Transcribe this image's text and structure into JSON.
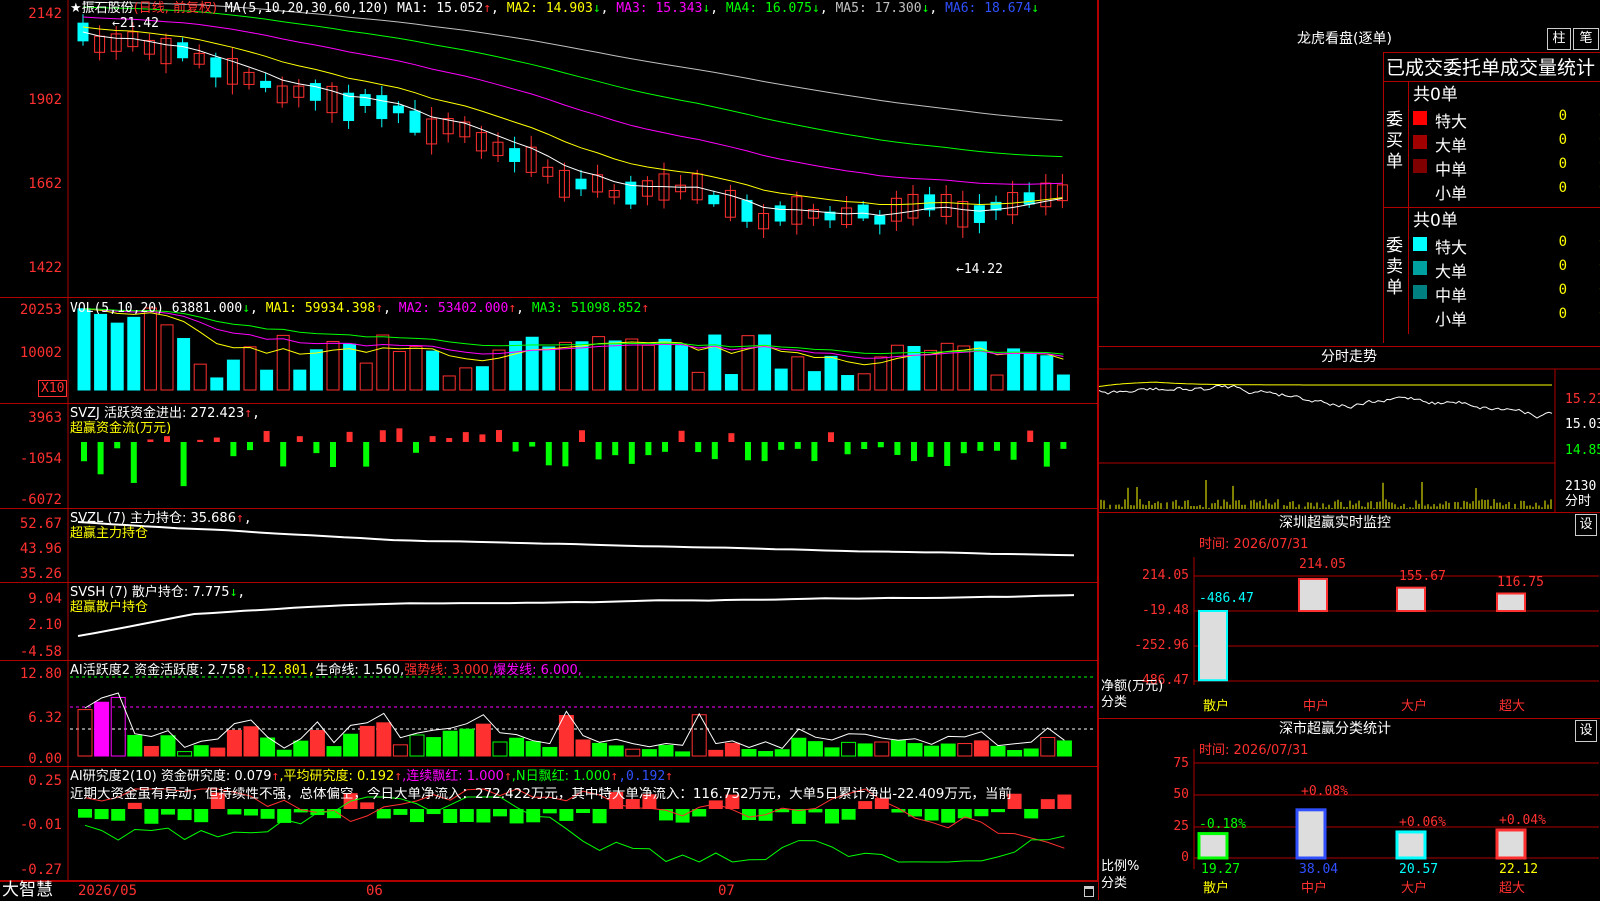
{
  "colors": {
    "up": "#ff3030",
    "down": "#00ffff",
    "ma1": "#ffffff",
    "ma2": "#ffff00",
    "ma3": "#ff00ff",
    "ma4": "#00ff00",
    "ma5": "#c0c0c0",
    "ma6": "#3050ff",
    "grid": "#b00000"
  },
  "header": {
    "stock": "★振石股份",
    "period": "(日线, 前复权)",
    "ma_label": "MA(5,10,20,30,60,120)",
    "ma": [
      {
        "name": "MA1:",
        "value": "15.052",
        "arrow": "↑"
      },
      {
        "name": "MA2:",
        "value": "14.903",
        "arrow": "↓"
      },
      {
        "name": "MA3:",
        "value": "15.343",
        "arrow": "↓"
      },
      {
        "name": "MA4:",
        "value": "16.075",
        "arrow": "↓"
      },
      {
        "name": "MA5:",
        "value": "17.300",
        "arrow": "↓"
      },
      {
        "name": "MA6:",
        "value": "18.674",
        "arrow": "↓"
      }
    ]
  },
  "price_axis": [
    "2142",
    "1902",
    "1662",
    "1422"
  ],
  "price_marks": {
    "high": "←21.42",
    "low": "←14.22"
  },
  "vol": {
    "label": "VOL(5,10,20)",
    "value": "63881.000",
    "arrow": "↓",
    "ma1": "MA1: 59934.398",
    "ma1_arrow": "↑",
    "ma2": "MA2: 53402.000",
    "ma2_arrow": "↑",
    "ma3": "MA3: 51098.852",
    "ma3_arrow": "↑",
    "axis": [
      "20253",
      "10002"
    ],
    "mult": "X10"
  },
  "svzj": {
    "label": "SVZJ  活跃资金进出: 272.423",
    "arrow": "↑",
    "sub": "超赢资金流(万元)",
    "axis": [
      "3963",
      "-1054",
      "-6072"
    ]
  },
  "svzl": {
    "label": "SVZL (7) 主力持仓: 35.686",
    "arrow": "↑",
    "comma": ",",
    "sub": "超赢主力持仓",
    "axis": [
      "52.67",
      "43.96",
      "35.26"
    ]
  },
  "svsh": {
    "label": "SVSH (7) 散户持仓: 7.775",
    "arrow": "↓",
    "comma": ",",
    "sub": "超赢散户持仓",
    "axis": [
      "9.04",
      "2.10",
      "-4.58"
    ]
  },
  "ai1": {
    "label": "AI活跃度2 资金活跃度: 2.758",
    "arrow": "↑",
    "v2": ",12.801,",
    "v3": "生命线: 1.560,",
    "v4": "强势线: 3.000,",
    "v5": "爆发线: 6.000,",
    "axis": [
      "12.80",
      "6.32",
      "0.00"
    ]
  },
  "ai2": {
    "label": "AI研究度2(10) 资金研究度: 0.079",
    "arrow": "↑",
    "v2": ",平均研究度: 0.192",
    "a2": "↑",
    "v3": ",连续飘红: 1.000",
    "a3": "↑",
    "v4": ",N日飘红: 1.000",
    "a4": "↑",
    "v5": ",0.192",
    "a5": "↑",
    "desc": "近期大资金虽有异动，但持续性不强，总体偏空，今日大单净流入：272.422万元，其中特大单净流入：116.752万元，大单5日累计净出-22.409万元，当前",
    "axis": [
      "0.25",
      "-0.01",
      "-0.27"
    ]
  },
  "dates": [
    "2026/05",
    "06",
    "07"
  ],
  "brand": "大智慧",
  "right": {
    "title": "龙虎看盘(逐单)",
    "btn_zhu": "柱",
    "btn_bi": "笔",
    "table_title": "已成交委托单成交量统计",
    "buy": {
      "side": "委买单",
      "total": "共0单",
      "rows": [
        {
          "name": "特大",
          "n": "0",
          "p": "0%",
          "c": "#ff0000"
        },
        {
          "name": "大单",
          "n": "0",
          "p": "0%",
          "c": "#a00000"
        },
        {
          "name": "中单",
          "n": "0",
          "p": "0%",
          "c": "#800000"
        },
        {
          "name": "小单",
          "n": "0",
          "p": "0%",
          "c": "#000000"
        }
      ]
    },
    "sell": {
      "side": "委卖单",
      "total": "共0单",
      "rows": [
        {
          "name": "特大",
          "n": "0",
          "p": "0%",
          "c": "#00ffff"
        },
        {
          "name": "大单",
          "n": "0",
          "p": "0%",
          "c": "#00a0a0"
        },
        {
          "name": "中单",
          "n": "0",
          "p": "0%",
          "c": "#008080"
        },
        {
          "name": "小单",
          "n": "0",
          "p": "0%",
          "c": "#000000"
        }
      ]
    },
    "intraday": {
      "title": "分时走势",
      "axis": [
        "15.21",
        "15.03",
        "14.85"
      ],
      "vol_axis": [
        "2130",
        "分时"
      ]
    },
    "monitor": {
      "title": "深圳超赢实时监控",
      "btn": "设",
      "time": "时间: 2026/07/31",
      "axis": [
        "214.05",
        "-19.48",
        "-252.96",
        "-486.47"
      ],
      "ylab": "净额(万元)",
      "xlab": "分类",
      "cats": [
        "散户",
        "中户",
        "大户",
        "超大"
      ],
      "values": [
        "-486.47",
        "214.05",
        "155.67",
        "116.75"
      ],
      "nums": [
        -486.47,
        214.05,
        155.67,
        116.75
      ]
    },
    "stats": {
      "title": "深市超赢分类统计",
      "btn": "设",
      "time": "时间: 2026/07/31",
      "axis": [
        "75",
        "50",
        "25",
        "0"
      ],
      "ylab": "比例%",
      "xlab": "分类",
      "cats": [
        "散户",
        "中户",
        "大户",
        "超大"
      ],
      "pct": [
        "19.27",
        "38.04",
        "20.57",
        "22.12"
      ],
      "chg": [
        "-0.18%",
        "+0.08%",
        "+0.06%",
        "+0.04%"
      ],
      "nums": [
        19.27,
        38.04,
        20.57,
        22.12
      ]
    }
  }
}
